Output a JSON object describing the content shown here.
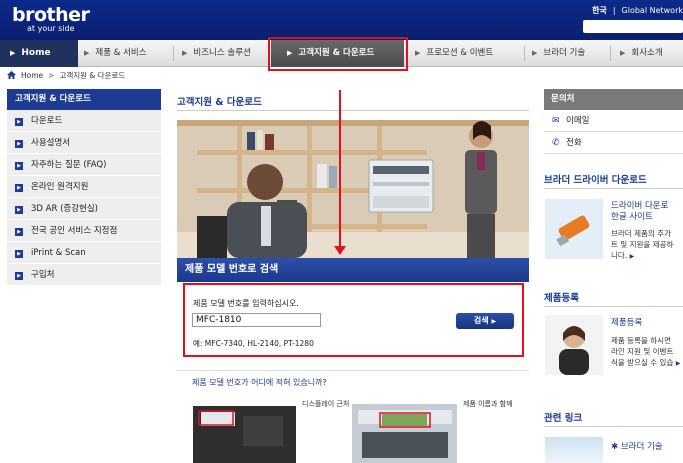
{
  "header": {
    "logo": "brother",
    "tagline": "at your side",
    "lang": "한국",
    "global_link": "Global Network"
  },
  "nav": {
    "home": "Home",
    "items": [
      "제품 & 서비스",
      "비즈니스 솔루션",
      "고객지원 & 다운로드",
      "프로모션 & 이벤트",
      "브라더 기술",
      "회사소개"
    ]
  },
  "breadcrumb": {
    "home": "Home",
    "current": "고객지원 & 다운로드"
  },
  "sidebar": {
    "title": "고객지원 & 다운로드",
    "items": [
      "다운로드",
      "사용설명서",
      "자주하는 질문 (FAQ)",
      "온라인 원격지원",
      "3D AR (증강현실)",
      "전국 공인 서비스 지정점",
      "iPrint & Scan",
      "구입처"
    ]
  },
  "main": {
    "title": "고객지원 & 다운로드",
    "search": {
      "heading": "제품 모델 번호로 검색",
      "label": "제품 모델 번호를 입력하십시오.",
      "value": "MFC-1810",
      "button": "검색",
      "example": "예: MFC-7340, HL-2140, PT-1280"
    },
    "where": {
      "title": "제품 모델 번호가 어디에 적혀 있습니까?",
      "device1_label": "디스플레이 근처",
      "device2_label": "제품 이름과 함께"
    }
  },
  "right": {
    "contact": {
      "title": "문의처",
      "email": "이메일",
      "phone": "전화"
    },
    "driver": {
      "section": "브라더 드라이버 다운로드",
      "title_line1": "드라이버 다운로",
      "title_line2": "한글 사이트",
      "body_line1": "브라더 제품의 추가",
      "body_line2": "트 및 지원을 제공하",
      "body_line3": "니다."
    },
    "register": {
      "section": "제품등록",
      "title": "제품등록",
      "body_line1": "제품 등록을 하시면",
      "body_line2": "라인 지원 및 이벤트",
      "body_line3": "식을 받으실 수 있습"
    },
    "links": {
      "section": "관련 링크",
      "item": "브라더 기술"
    }
  },
  "colors": {
    "brand_blue": "#1d3b93",
    "highlight_red": "#e01020"
  }
}
